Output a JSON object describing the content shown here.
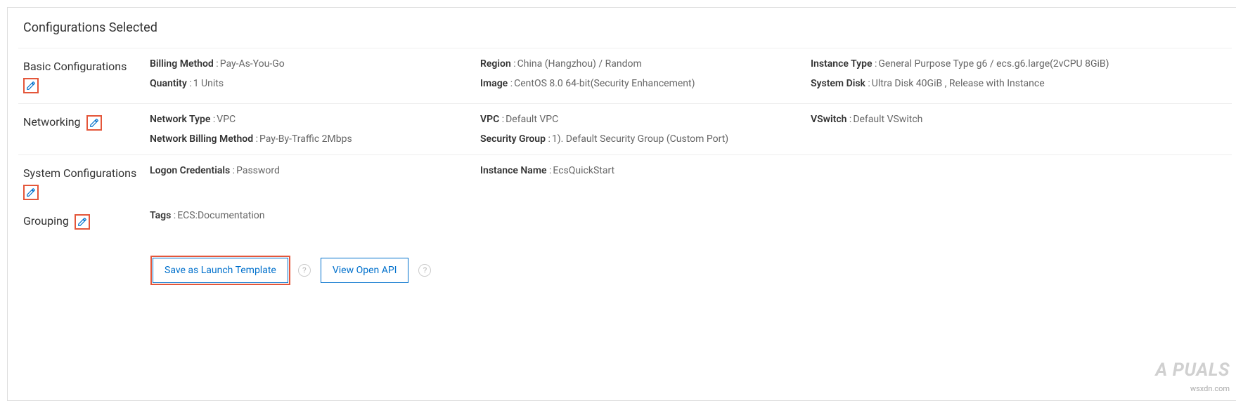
{
  "title": "Configurations Selected",
  "sections": {
    "basic": {
      "label": "Basic Configurations",
      "billing_method_label": "Billing Method",
      "billing_method_value": "Pay-As-You-Go",
      "quantity_label": "Quantity",
      "quantity_value": "1 Units",
      "region_label": "Region",
      "region_value": "China (Hangzhou) / Random",
      "image_label": "Image",
      "image_value": "CentOS 8.0 64-bit(Security Enhancement)",
      "instance_type_label": "Instance Type",
      "instance_type_value": "General Purpose Type g6 / ecs.g6.large(2vCPU 8GiB)",
      "system_disk_label": "System Disk",
      "system_disk_value": "Ultra Disk 40GiB , Release with Instance"
    },
    "networking": {
      "label": "Networking",
      "network_type_label": "Network Type",
      "network_type_value": "VPC",
      "network_billing_label": "Network Billing Method",
      "network_billing_value": "Pay-By-Traffic 2Mbps",
      "vpc_label": "VPC",
      "vpc_value": "Default VPC",
      "security_group_label": "Security Group",
      "security_group_value": "1). Default Security Group (Custom Port)",
      "vswitch_label": "VSwitch",
      "vswitch_value": "Default VSwitch"
    },
    "system": {
      "label": "System Configurations",
      "logon_label": "Logon Credentials",
      "logon_value": "Password",
      "instance_name_label": "Instance Name",
      "instance_name_value": "EcsQuickStart"
    },
    "grouping": {
      "label": "Grouping",
      "tags_label": "Tags",
      "tags_value": "ECS:Documentation"
    }
  },
  "footer": {
    "save_template": "Save as Launch Template",
    "view_api": "View Open API"
  },
  "watermark": "wsxdn.com",
  "logo": "A  PUALS"
}
